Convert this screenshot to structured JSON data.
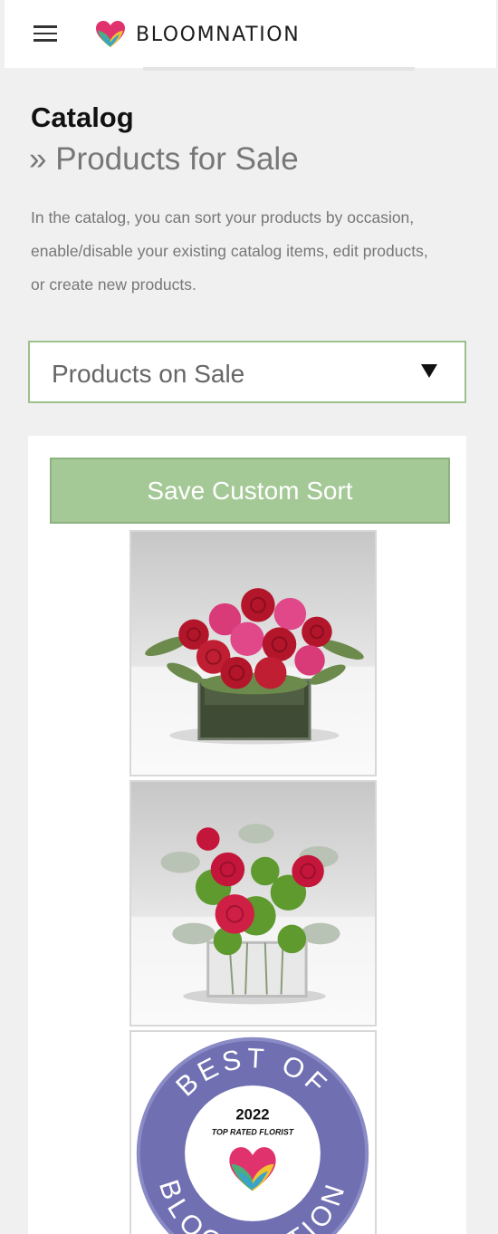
{
  "header": {
    "brand_name": "BLOOMNATION"
  },
  "page": {
    "title": "Catalog",
    "subtitle": "» Products for Sale",
    "description": "In the catalog, you can sort your products by occasion, enable/disable your existing catalog items, edit products, or create new products."
  },
  "filter": {
    "selected": "Products on Sale"
  },
  "actions": {
    "save_label": "Save Custom Sort"
  },
  "badge": {
    "top_text": "BEST OF",
    "year": "2022",
    "tagline": "TOP RATED FLORIST",
    "bottom_text": "BLOOMNATION"
  },
  "colors": {
    "accent": "#a4c996",
    "accent_border": "#9cc08e",
    "badge_purple": "#6f6fb2"
  }
}
